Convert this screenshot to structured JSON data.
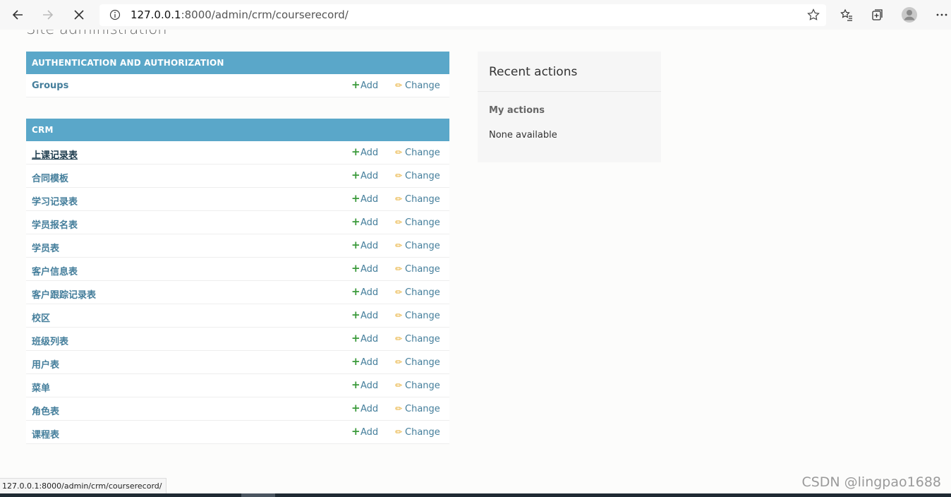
{
  "browser": {
    "url_host": "127.0.0.1",
    "url_rest": ":8000/admin/crm/courserecord/"
  },
  "page": {
    "site_title": "Site administration"
  },
  "modules": [
    {
      "caption": "Authentication and Authorization",
      "rows": [
        {
          "name": "Groups",
          "add": "Add",
          "change": "Change"
        }
      ]
    },
    {
      "caption": "CRM",
      "rows": [
        {
          "name": "上课记录表",
          "add": "Add",
          "change": "Change"
        },
        {
          "name": "合同模板",
          "add": "Add",
          "change": "Change"
        },
        {
          "name": "学习记录表",
          "add": "Add",
          "change": "Change"
        },
        {
          "name": "学员报名表",
          "add": "Add",
          "change": "Change"
        },
        {
          "name": "学员表",
          "add": "Add",
          "change": "Change"
        },
        {
          "name": "客户信息表",
          "add": "Add",
          "change": "Change"
        },
        {
          "name": "客户跟踪记录表",
          "add": "Add",
          "change": "Change"
        },
        {
          "name": "校区",
          "add": "Add",
          "change": "Change"
        },
        {
          "name": "班级列表",
          "add": "Add",
          "change": "Change"
        },
        {
          "name": "用户表",
          "add": "Add",
          "change": "Change"
        },
        {
          "name": "菜单",
          "add": "Add",
          "change": "Change"
        },
        {
          "name": "角色表",
          "add": "Add",
          "change": "Change"
        },
        {
          "name": "课程表",
          "add": "Add",
          "change": "Change"
        }
      ]
    }
  ],
  "recent_actions": {
    "title": "Recent actions",
    "subtitle": "My actions",
    "empty_text": "None available"
  },
  "status_bar": "127.0.0.1:8000/admin/crm/courserecord/",
  "watermark": "CSDN @lingpao1688",
  "colors": {
    "module_header": "#5aa7c9",
    "link": "#447e9b",
    "add_icon": "#3a9a3a",
    "change_icon": "#e5a722"
  }
}
